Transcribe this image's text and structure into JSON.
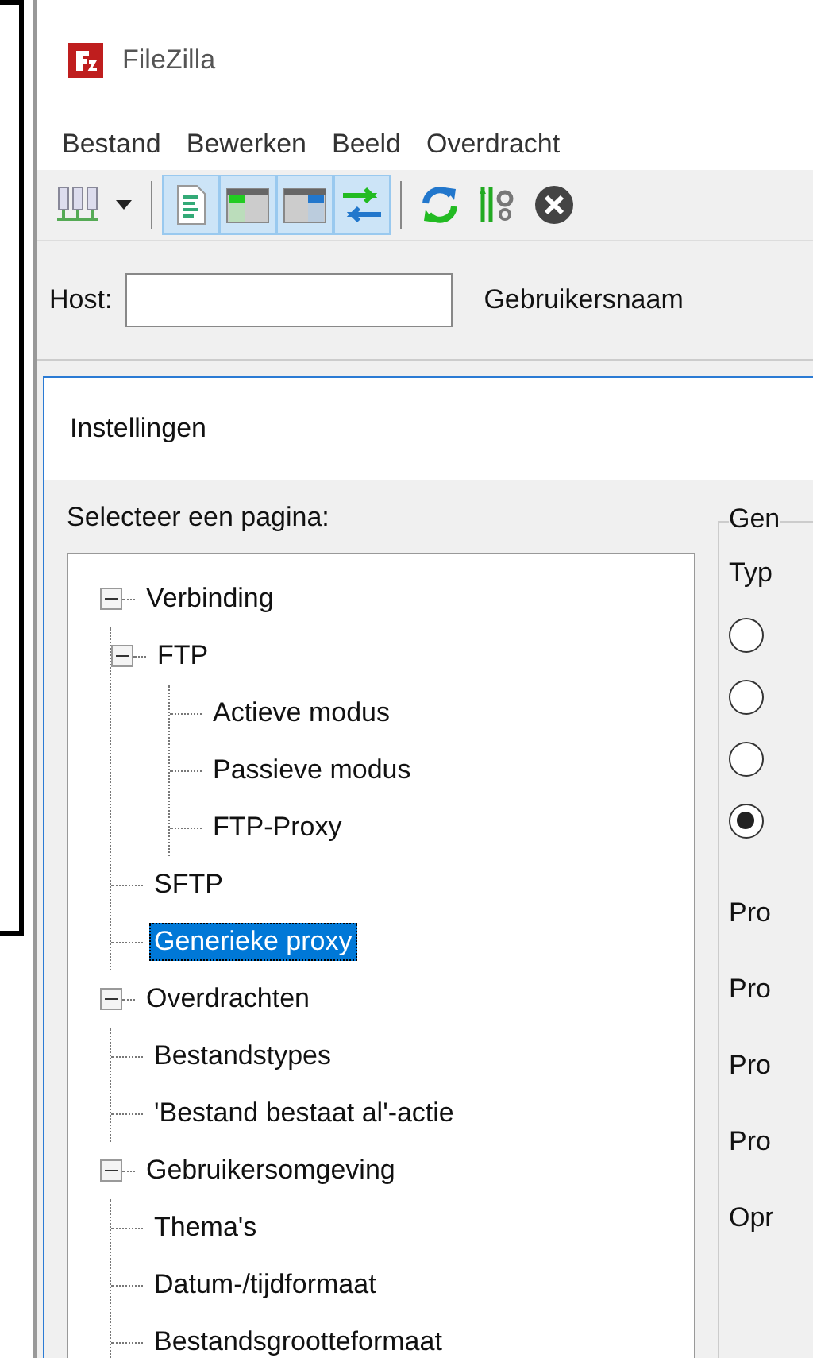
{
  "app": {
    "title": "FileZilla",
    "menu": [
      "Bestand",
      "Bewerken",
      "Beeld",
      "Overdracht"
    ],
    "toolbar": [
      {
        "kind": "sitemanager",
        "on": false
      },
      {
        "kind": "dropdown",
        "on": false
      },
      {
        "kind": "separator"
      },
      {
        "kind": "log",
        "on": true
      },
      {
        "kind": "localtree",
        "on": true
      },
      {
        "kind": "remotetree",
        "on": true
      },
      {
        "kind": "queue",
        "on": true
      },
      {
        "kind": "separator"
      },
      {
        "kind": "refresh",
        "on": false
      },
      {
        "kind": "filter",
        "on": false
      },
      {
        "kind": "cancel",
        "on": false
      }
    ],
    "quickconnect": {
      "host_label": "Host:",
      "user_label": "Gebruikersnaam"
    }
  },
  "dialog": {
    "title": "Instellingen",
    "tree_label": "Selecteer een pagina:",
    "tree": [
      {
        "label": "Verbinding",
        "expanded": true,
        "selected": false,
        "children": [
          {
            "label": "FTP",
            "expanded": true,
            "selected": false,
            "children": [
              {
                "label": "Actieve modus",
                "selected": false
              },
              {
                "label": "Passieve modus",
                "selected": false
              },
              {
                "label": "FTP-Proxy",
                "selected": false
              }
            ]
          },
          {
            "label": "SFTP",
            "selected": false
          },
          {
            "label": "Generieke proxy",
            "selected": true
          }
        ]
      },
      {
        "label": "Overdrachten",
        "expanded": true,
        "selected": false,
        "children": [
          {
            "label": "Bestandstypes",
            "selected": false
          },
          {
            "label": "'Bestand bestaat al'-actie",
            "selected": false
          }
        ]
      },
      {
        "label": "Gebruikersomgeving",
        "expanded": true,
        "selected": false,
        "children": [
          {
            "label": "Thema's",
            "selected": false
          },
          {
            "label": "Datum-/tijdformaat",
            "selected": false
          },
          {
            "label": "Bestandsgrootteformaat",
            "selected": false
          }
        ]
      }
    ],
    "group": {
      "title": "Gen",
      "type_label": "Typ",
      "radios": [
        {
          "checked": false
        },
        {
          "checked": false
        },
        {
          "checked": false
        },
        {
          "checked": true
        }
      ],
      "field_labels": [
        "Pro",
        "Pro",
        "Pro",
        "Pro",
        "Opr"
      ]
    }
  }
}
